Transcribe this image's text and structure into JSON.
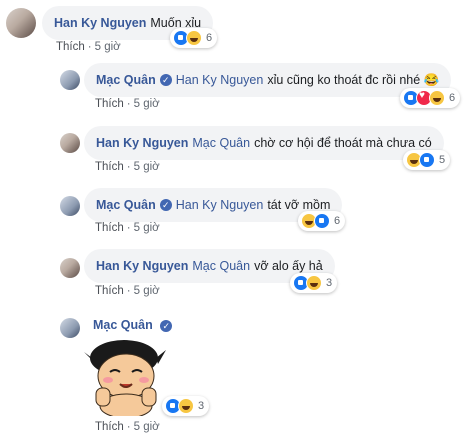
{
  "comments": [
    {
      "author": "Han Ky Nguyen",
      "tag": "",
      "text": "Muốn xỉu",
      "like": "Thích",
      "time": "5 giờ",
      "reactions": [
        "like",
        "haha"
      ],
      "count": "6",
      "verified": false
    },
    {
      "author": "Mạc Quân",
      "tag": "Han Ky Nguyen",
      "text": "xỉu cũng ko thoát đc rồi nhé 😂",
      "like": "Thích",
      "time": "5 giờ",
      "reactions": [
        "like",
        "love",
        "haha"
      ],
      "count": "6",
      "verified": true
    },
    {
      "author": "Han Ky Nguyen",
      "tag": "Mạc Quân",
      "text": "chờ cơ hội để thoát mà chưa có",
      "like": "Thích",
      "time": "5 giờ",
      "reactions": [
        "haha",
        "like"
      ],
      "count": "5",
      "verified": false
    },
    {
      "author": "Mạc Quân",
      "tag": "Han Ky Nguyen",
      "text": "tát vỡ mồm",
      "like": "Thích",
      "time": "5 giờ",
      "reactions": [
        "haha",
        "like"
      ],
      "count": "6",
      "verified": true
    },
    {
      "author": "Han Ky Nguyen",
      "tag": "Mạc Quân",
      "text": "vỡ alo ấy hả",
      "like": "Thích",
      "time": "5 giờ",
      "reactions": [
        "like",
        "haha"
      ],
      "count": "3",
      "verified": false
    },
    {
      "author": "Mạc Quân",
      "tag": "",
      "text": "",
      "like": "Thích",
      "time": "5 giờ",
      "reactions": [
        "like",
        "haha"
      ],
      "count": "3",
      "verified": true
    }
  ],
  "icons": {
    "verified": "check-badge-icon",
    "like": "like-reaction-icon",
    "haha": "haha-reaction-icon",
    "love": "love-reaction-icon"
  },
  "colors": {
    "name": "#385898",
    "bubble": "#f2f3f5",
    "like": "#1877f2",
    "love": "#f0284a",
    "haha": "#f7c642"
  }
}
